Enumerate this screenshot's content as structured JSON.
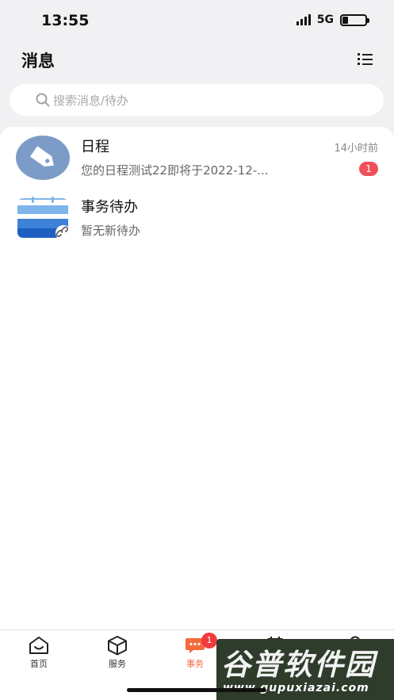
{
  "status_bar": {
    "time": "13:55",
    "network": "5G",
    "battery_level": 0.25
  },
  "header": {
    "title": "消息",
    "menu_icon": "list-menu-icon"
  },
  "search": {
    "placeholder": "搜索消息/待办",
    "icon": "search-icon"
  },
  "messages": [
    {
      "title": "日程",
      "subtitle": "您的日程测试22即将于2022-12-...",
      "time": "14小时前",
      "badge": "1",
      "icon": "tag-icon",
      "color": "#7c9cc7"
    },
    {
      "title": "事务待办",
      "subtitle": "暂无新待办",
      "icon": "calendar-link-icon",
      "color": "#3d82d8"
    }
  ],
  "tabbar": {
    "tabs": [
      {
        "label": "首页",
        "icon": "home-icon"
      },
      {
        "label": "服务",
        "icon": "cube-icon"
      },
      {
        "label": "事务",
        "icon": "chat-bubble-icon",
        "badge": "1",
        "active": true
      },
      {
        "label": "",
        "icon": "calendar-icon"
      },
      {
        "label": "",
        "icon": "user-icon"
      }
    ],
    "accent_color": "#f46a3c"
  },
  "watermark": {
    "title": "谷普软件园",
    "url": "www.gupuxiazai.com"
  }
}
